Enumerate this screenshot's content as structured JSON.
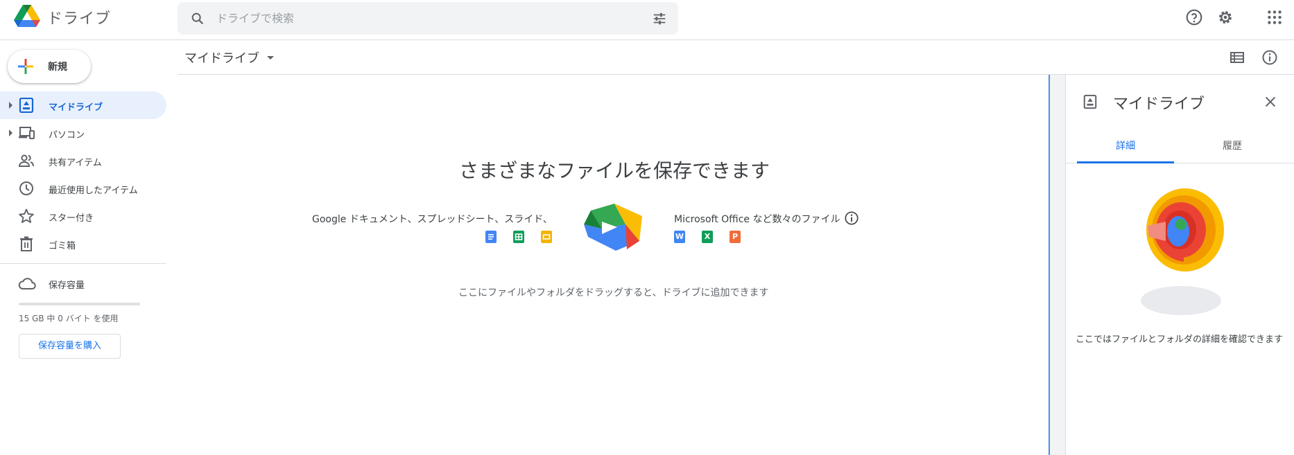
{
  "header": {
    "app_title": "ドライブ",
    "search_placeholder": "ドライブで検索",
    "icons": [
      "drive-logo-icon",
      "search-icon",
      "tune-icon",
      "help-icon",
      "settings-icon",
      "apps-grid-icon"
    ]
  },
  "sidebar": {
    "new_label": "新規",
    "items": [
      {
        "label": "マイドライブ",
        "icon": "my-drive-icon",
        "active": true,
        "expandable": true
      },
      {
        "label": "パソコン",
        "icon": "computers-icon",
        "active": false,
        "expandable": true
      },
      {
        "label": "共有アイテム",
        "icon": "shared-icon",
        "active": false,
        "expandable": false
      },
      {
        "label": "最近使用したアイテム",
        "icon": "recent-icon",
        "active": false,
        "expandable": false
      },
      {
        "label": "スター付き",
        "icon": "star-icon",
        "active": false,
        "expandable": false
      },
      {
        "label": "ゴミ箱",
        "icon": "trash-icon",
        "active": false,
        "expandable": false
      }
    ],
    "storage": {
      "label": "保存容量",
      "used_fraction": 0,
      "usage_text": "15 GB 中 0 バイト を使用",
      "buy_label": "保存容量を購入"
    }
  },
  "toolbar": {
    "breadcrumb": "マイドライブ",
    "icons": [
      "list-view-icon",
      "info-icon"
    ]
  },
  "main": {
    "empty_title": "さまざまなファイルを保存できます",
    "left_caption": "Google ドキュメント、スプレッドシート、スライド、",
    "right_caption": "Microsoft Office など数々のファイル",
    "drop_hint": "ここにファイルやフォルダをドラッグすると、ドライブに追加できます",
    "google_icons": [
      {
        "name": "docs-icon",
        "color": "#4285f4"
      },
      {
        "name": "sheets-icon",
        "color": "#0f9d58"
      },
      {
        "name": "slides-icon",
        "color": "#f4b400"
      }
    ],
    "office_icons": [
      {
        "name": "word-icon",
        "letter": "W",
        "color": "#4285f4"
      },
      {
        "name": "excel-icon",
        "letter": "X",
        "color": "#0f9d58"
      },
      {
        "name": "powerpoint-icon",
        "letter": "P",
        "color": "#f06d3a"
      }
    ]
  },
  "details": {
    "title": "マイドライブ",
    "tabs": [
      {
        "label": "詳細",
        "active": true
      },
      {
        "label": "履歴",
        "active": false
      }
    ],
    "caption": "ここではファイルとフォルダの詳細を確認できます"
  },
  "colors": {
    "accent": "#1a73e8",
    "active_nav_bg": "#e8f0fe",
    "text": "#3c4043",
    "muted": "#5f6368"
  }
}
